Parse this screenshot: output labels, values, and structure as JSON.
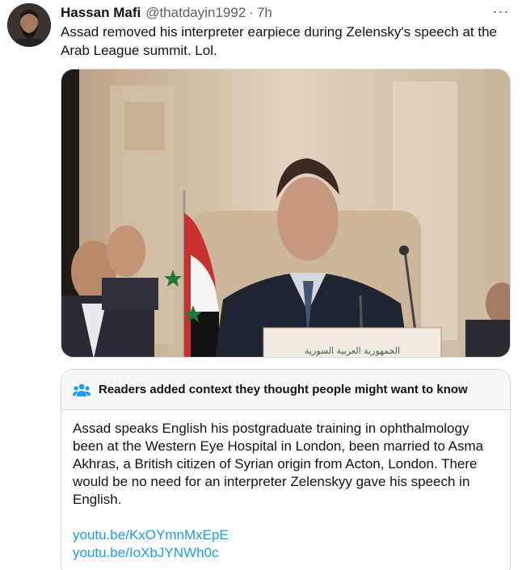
{
  "tweet": {
    "author_name": "Hassan Mafi",
    "author_handle": "@thatdayin1992",
    "separator": "·",
    "time": "7h",
    "more_icon": "more-horizontal-icon",
    "text": "Assad removed his interpreter earpiece during Zelensky's speech at the Arab League summit. Lol."
  },
  "media": {
    "caption_text_on_placard": "الجمهورية العربية السورية"
  },
  "community_note": {
    "icon": "people-icon",
    "title": "Readers added context they thought people might want to know",
    "body": "Assad speaks English his postgraduate training in ophthalmology been at the Western Eye Hospital in London, been  married to Asma Akhras, a British citizen of Syrian origin from Acton, London. There would be no need for an interpreter Zelenskyy gave his speech in English.",
    "links": [
      "youtu.be/KxOYmnMxEpE",
      "youtu.be/IoXbJYNWh0c"
    ]
  },
  "colors": {
    "link": "#1d9bf0",
    "secondary_text": "#536471",
    "border": "#cfd9de"
  }
}
